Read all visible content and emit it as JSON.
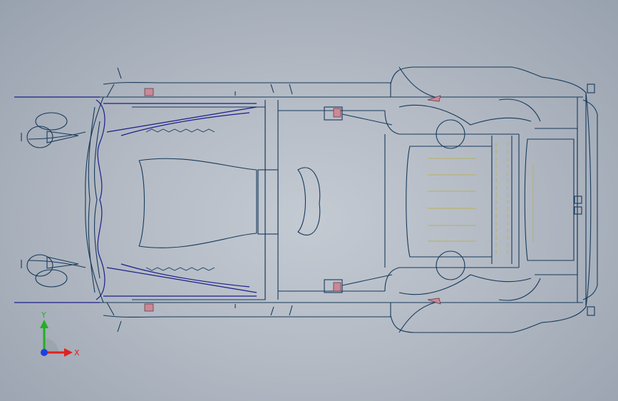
{
  "viewport": {
    "background_top": "#98a1ae",
    "background_center": "#c4cad2"
  },
  "model": {
    "description_icon": "car-chassis-wireframe",
    "line_color": "#173a5c",
    "accent_line_color": "#1b1f8a",
    "seat_color": "#b9b15a",
    "highlight_color": "#c98a96"
  },
  "triad": {
    "x_label": "X",
    "y_label": "Y",
    "x_color": "#e02020",
    "y_color": "#21b021",
    "z_color": "#1f3fe0"
  }
}
